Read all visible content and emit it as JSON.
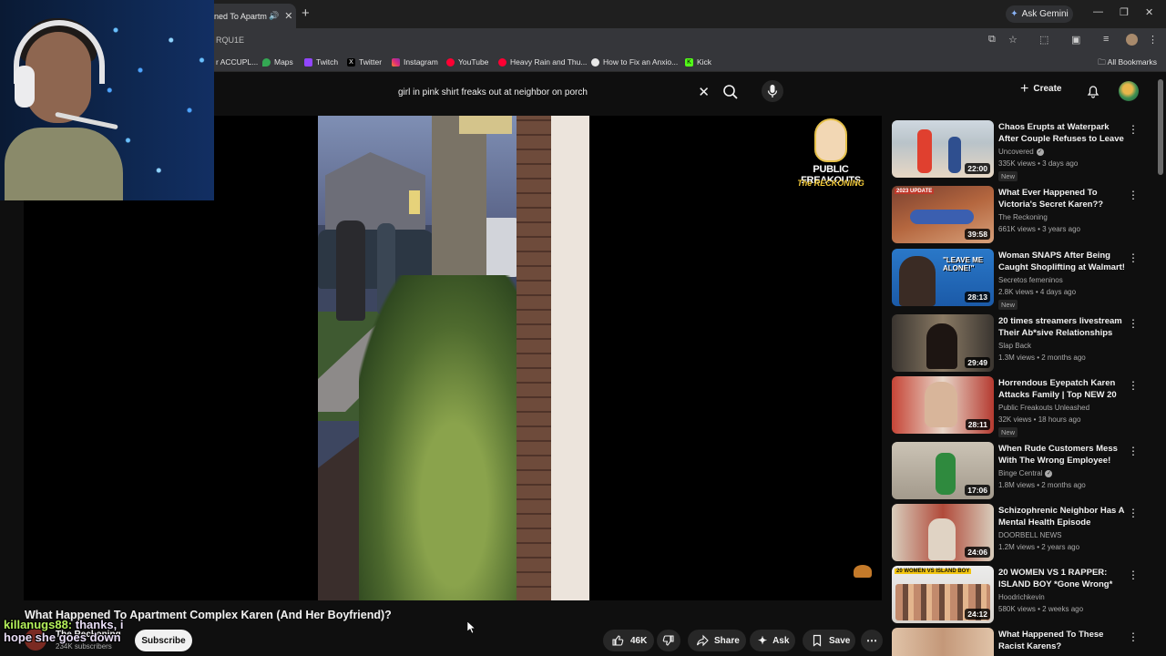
{
  "browser": {
    "tab_title": "ned To Apartm",
    "url": "RQU1E",
    "gemini_label": "Ask Gemini",
    "bookmarks": [
      {
        "label": "r ACCUPL...",
        "icon": "bookmark-icon"
      },
      {
        "label": "Maps",
        "icon": "maps-icon"
      },
      {
        "label": "Twitch",
        "icon": "twitch-icon"
      },
      {
        "label": "Twitter",
        "icon": "x-icon"
      },
      {
        "label": "Instagram",
        "icon": "instagram-icon"
      },
      {
        "label": "YouTube",
        "icon": "youtube-icon"
      },
      {
        "label": "Heavy Rain and Thu...",
        "icon": "youtube-icon"
      },
      {
        "label": "How to Fix an Anxio...",
        "icon": "web-icon"
      },
      {
        "label": "Kick",
        "icon": "kick-icon"
      }
    ],
    "all_bookmarks": "All Bookmarks"
  },
  "masthead": {
    "search_query": "girl in pink shirt freaks out at neighbor on porch",
    "create_label": "Create"
  },
  "player": {
    "watermark_title": "PUBLIC FREAKOUTS",
    "watermark_subtitle": "The RECKONING"
  },
  "video": {
    "title": "What Happened To Apartment Complex Karen (And Her Boyfriend)?",
    "channel": "The Reckoning",
    "subscribers": "234K subscribers",
    "subscribe_label": "Subscribe",
    "likes": "46K",
    "share_label": "Share",
    "ask_label": "Ask",
    "save_label": "Save"
  },
  "chat": {
    "username": "killanugs88:",
    "message_part1": "thanks, i",
    "message_part2": "hope she goes down"
  },
  "recommendations": [
    {
      "title": "Chaos Erupts at Waterpark After Couple Refuses to Leave",
      "channel": "Uncovered",
      "verified": true,
      "meta": "335K views • 3 days ago",
      "duration": "22:00",
      "badge": "New"
    },
    {
      "title": "What Ever Happened To Victoria's Secret Karen??",
      "channel": "The Reckoning",
      "verified": false,
      "meta": "661K views • 3 years ago",
      "duration": "39:58",
      "badge": ""
    },
    {
      "title": "Woman SNAPS After Being Caught Shoplifting at Walmart!",
      "channel": "Secretos femeninos",
      "verified": false,
      "meta": "2.8K views • 4 days ago",
      "duration": "28:13",
      "badge": "New"
    },
    {
      "title": "20 times streamers livestream Their Ab*sive Relationships",
      "channel": "Slap Back",
      "verified": false,
      "meta": "1.3M views • 2 months ago",
      "duration": "29:49",
      "badge": ""
    },
    {
      "title": "Horrendous Eyepatch Karen Attacks Family | Top NEW 20 ...",
      "channel": "Public Freakouts Unleashed",
      "verified": false,
      "meta": "32K views • 18 hours ago",
      "duration": "28:11",
      "badge": "New"
    },
    {
      "title": "When Rude Customers Mess With The Wrong Employee!",
      "channel": "Binge Central",
      "verified": true,
      "meta": "1.8M views • 2 months ago",
      "duration": "17:06",
      "badge": ""
    },
    {
      "title": "Schizophrenic Neighbor Has A Mental Health Episode",
      "channel": "DOORBELL NEWS",
      "verified": false,
      "meta": "1.2M views • 2 years ago",
      "duration": "24:06",
      "badge": ""
    },
    {
      "title": "20 WOMEN VS 1 RAPPER: ISLAND BOY *Gone Wrong*",
      "channel": "Hoodrichkevin",
      "verified": false,
      "meta": "580K views • 2 weeks ago",
      "duration": "24:12",
      "badge": ""
    },
    {
      "title": "What Happened To These Racist Karens?",
      "channel": "",
      "verified": false,
      "meta": "",
      "duration": "",
      "badge": ""
    }
  ],
  "thumb_text": {
    "t2": "2023 UPDATE",
    "t3": "\"LEAVE ME ALONE!\"",
    "t8": "20 WOMEN VS ISLAND BOY"
  },
  "colors": {
    "background": "#0f0f0f",
    "pill": "#272727",
    "chat_username": "#b4f05a",
    "watermark_accent": "#f2c938"
  }
}
